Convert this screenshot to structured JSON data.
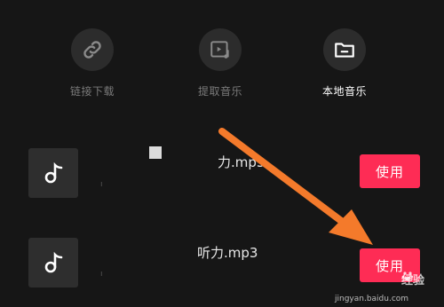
{
  "tabs": [
    {
      "label": "链接下载",
      "icon": "link-icon",
      "active": false
    },
    {
      "label": "提取音乐",
      "icon": "video-music-icon",
      "active": false
    },
    {
      "label": "本地音乐",
      "icon": "folder-icon",
      "active": true
    }
  ],
  "songs": [
    {
      "name": "力.mp3",
      "sub": "ı",
      "button": "使用"
    },
    {
      "name": "听力.mp3",
      "sub": "ı",
      "button": "使用"
    }
  ],
  "watermark": {
    "brand": "经验",
    "url": "jingyan.baidu.com"
  },
  "colors": {
    "background": "#161616",
    "accent": "#fe2c55",
    "arrow": "#f47a2b",
    "inactive_text": "#7a7a7a"
  }
}
